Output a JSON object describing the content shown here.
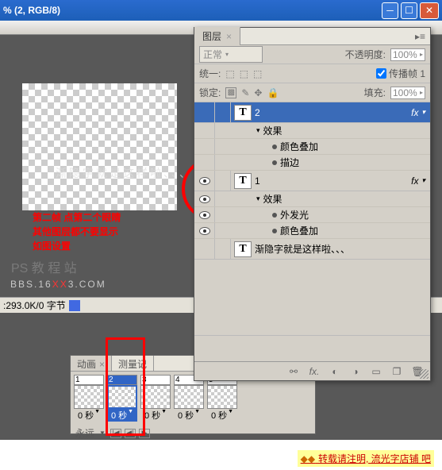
{
  "titlebar": {
    "title": "% (2, RGB/8)"
  },
  "canvas": {
    "ghost_text": "渐隐字就是这样啦、、、",
    "red_note_l1": "第二帧  点第二个眼睛",
    "red_note_l2": "其他图层都不要显示",
    "red_note_l3": "如图设置",
    "tutorial_tag": "PS 教 程 站",
    "watermark_pre": "BBS.16",
    "watermark_mid": "XX",
    "watermark_post": "3.COM"
  },
  "statusbar": {
    "text": ":293.0K/0 字节"
  },
  "animation_panel": {
    "tab_anim": "动画",
    "tab_measure": "测量记",
    "frames": [
      {
        "num": "1",
        "time": "0 秒"
      },
      {
        "num": "2",
        "time": "0 秒",
        "selected": true
      },
      {
        "num": "3",
        "time": "0 秒"
      },
      {
        "num": "4",
        "time": "0 秒"
      },
      {
        "num": "5",
        "time": "0 秒"
      }
    ],
    "loop": "永远"
  },
  "layers_panel": {
    "tab": "图层",
    "blend_mode": "正常",
    "opacity_label": "不透明度:",
    "opacity_value": "100%",
    "unify_label": "统一:",
    "propagate_label": "传播帧 1",
    "lock_label": "锁定:",
    "fill_label": "填充:",
    "fill_value": "100%",
    "fx_label": "fx",
    "layers": [
      {
        "name": "2",
        "selected": true,
        "effects_label": "效果",
        "subs": [
          "颜色叠加",
          "描边"
        ]
      },
      {
        "name": "1",
        "selected": false,
        "effects_label": "效果",
        "subs": [
          "外发光",
          "颜色叠加"
        ]
      },
      {
        "name": "渐隐字就是这样啦、、、",
        "selected": false,
        "no_fx": true
      }
    ]
  },
  "reprint": {
    "text": "转载请注明, 流光字店铺  吧"
  }
}
